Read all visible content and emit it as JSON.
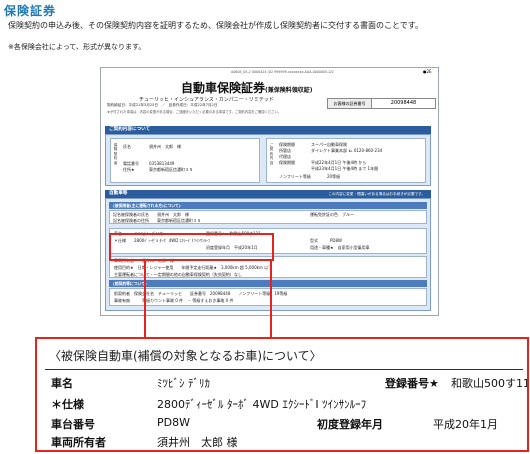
{
  "header": {
    "title": "保険証券",
    "intro": "保険契約の申込み後、その保険契約内容を証明するため、保険会社が作成し保険契約者に交付する書面のことです。",
    "note": "※各保険会社によって、形式が異なります。"
  },
  "document": {
    "top_line": "A0605_05-2  0000424  (02 999999-xxxxxxxx.AAA-0000005-2/2",
    "page_badge": "●2E",
    "title": "自動車保険証券",
    "title_sub": "(兼保険料領収証)",
    "company": "チューリッヒ・インシュアランス・カンパニー・リミテッド",
    "period_line": "契約締結日：平成21年3月25日　／　証券作成日：平成22年7月2日",
    "fine_print": "★が付された事項は、内容の変更がある場合、ご連絡をいただく必要のある事項です。ご契約内容をご確認ください。",
    "customer_label": "お客様の証券番号",
    "customer_number": "20098448",
    "section_contract": "ご契約内容について",
    "contract": {
      "name_label": "氏名",
      "name_value": "須井州　太郎　様",
      "phone_label": "電話番号",
      "phone_value": "0353813449",
      "address_label": "住所★",
      "address_value": "東京都新宿区信濃町３５",
      "left_vlabel": "保険契約者",
      "right_vlabel": "ご契約内容",
      "r_agent_label": "保険期間",
      "r_agent_value": "スーパー自動車保険",
      "r_contact_label": "所管店",
      "r_contact_value": "ダイレクト事業本部 ℡ 0120-860-234",
      "r_rep_label": "代理店",
      "r_period_label": "保険期間",
      "r_period_value": "平成22年4月1日 午後4時 から",
      "r_period_value2": "平成23年4月1日 午後4時 まで 1年間",
      "r_ncb_label": "ノンフリート等級",
      "r_ncb_value": "20等級"
    },
    "section_car": "自動車等",
    "section_car_right": "この内容に変更・間違いがある場合はお手続きが必要です。",
    "car_sub_band": "(被保険者(主に運転される方)について)",
    "car_rows": {
      "insured_name": "記名被保険者の氏名　　須井州　太郎　様",
      "insured_address": "記名被保険者の住所　　東京都新宿区信濃町３５",
      "license_color": "運転免許証の色　ブルー"
    },
    "vehicle_mini": {
      "name": "車名　　　ミツビシ デリカ",
      "reg": "登録番号★　和歌山500す111",
      "spec": "＊仕様　　2800ﾃﾞｨｰｾﾞﾙ ﾀｰﾎﾞ 4WD ｴｸｼｰﾄﾞⅠ ﾂｲﾝｻﾝﾙｰﾌ",
      "model": "型式　　　PD8W",
      "first_reg": "初度登録年月　平成20年1月",
      "purpose": "用途・車種★　自家用小型乗用車"
    },
    "owner_line": "車両所有者　　須井州　太郎　様",
    "usage_line": "使用目的★　日常・レジャー使用　　年間予定走行距離★　3,000km 超 5,000km 以下",
    "other_line": "主要運転者について・一定期間の他の自動車保険契約（失効契約）なし",
    "prev_band": "(前契約等について)",
    "prev_row1": "前契約者　保険会社名　チューリッヒ　　証券番号　20098448　　ノンフリート等級　19等級",
    "prev_row2": "事故有無　　　等級カウント事故 0 件　・ 等級すえおき事故 0 件"
  },
  "zoom": {
    "heading": "〈被保険自動車(補償の対象となるお車)について〉",
    "rows": [
      {
        "label": "車名",
        "value": "ﾐﾂﾋﾞｼ ﾃﾞﾘｶ",
        "right_label": "登録番号★",
        "right_value": "和歌山500す111"
      },
      {
        "label": "＊仕様",
        "value": "2800ﾃﾞｨｰｾﾞﾙ ﾀｰﾎﾞ 4WD ｴｸｼｰﾄﾞⅠ ﾂｲﾝｻﾝﾙｰﾌ"
      },
      {
        "label": "車台番号",
        "value": "PD8W",
        "right_label": "初度登録年月",
        "right_value": "平成20年1月"
      },
      {
        "label": "車両所有者",
        "value": "須井州　太郎 様"
      }
    ]
  }
}
